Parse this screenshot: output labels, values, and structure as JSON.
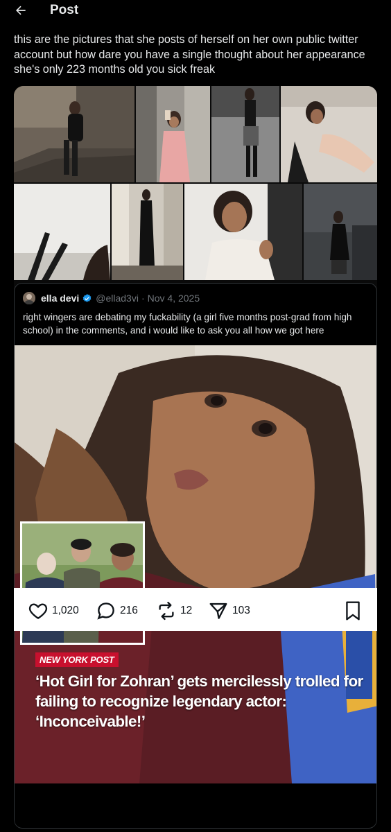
{
  "header": {
    "title": "Post",
    "back_icon": "arrow-left-icon"
  },
  "post": {
    "text": "this are the pictures that she posts of herself on her own public twitter account but how dare you have a single thought about her appearance she's only 223 months old you sick freak"
  },
  "quoted_post": {
    "author_name": "ella devi",
    "handle": "@ellad3vi",
    "separator": "·",
    "date": "Nov 4, 2025",
    "verified_icon": "verified-badge-icon",
    "text": "right wingers are debating my fuckability (a girl five months post-grad from high school) in the comments, and i would like to ask you all how we got here",
    "media": {
      "badge": "NEW YORK POST",
      "headline": "‘Hot Girl for Zohran’ gets mercilessly trolled for failing to recognize legendary actor: ‘Inconceivable!’"
    }
  },
  "actions": {
    "likes": "1,020",
    "replies": "216",
    "reposts": "12",
    "shares": "103",
    "like_icon": "heart-icon",
    "reply_icon": "reply-icon",
    "repost_icon": "repost-icon",
    "share_icon": "share-icon",
    "bookmark_icon": "bookmark-icon"
  },
  "colors": {
    "background": "#000000",
    "text": "#e7e9ea",
    "muted": "#71767b",
    "verified": "#1d9bf0",
    "nyp_red": "#c8102e"
  }
}
